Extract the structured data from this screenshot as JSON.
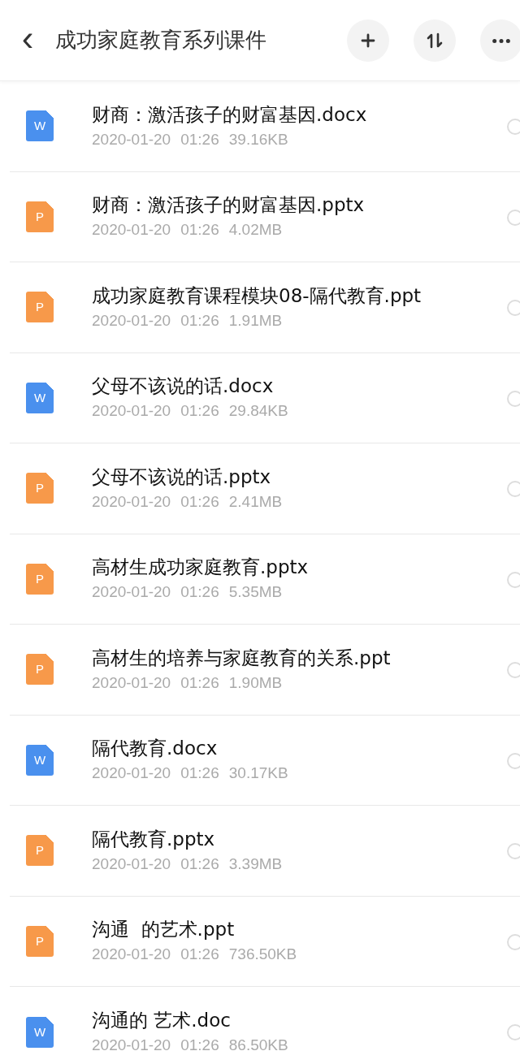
{
  "header": {
    "back": "‹",
    "title": "成功家庭教育系列课件",
    "actions": [
      {
        "kind": "add"
      },
      {
        "kind": "sort"
      },
      {
        "kind": "more"
      }
    ]
  },
  "files": [
    {
      "kind": "word",
      "badge": "W",
      "name": "财商：激活孩子的财富基因.docx",
      "date": "2020-01-20",
      "time": "01:26",
      "size": "39.16KB",
      "selected": false
    },
    {
      "kind": "ppt",
      "badge": "P",
      "name": "财商：激活孩子的财富基因.pptx",
      "date": "2020-01-20",
      "time": "01:26",
      "size": "4.02MB",
      "selected": false
    },
    {
      "kind": "ppt",
      "badge": "P",
      "name": "成功家庭教育课程模块08-隔代教育.ppt",
      "date": "2020-01-20",
      "time": "01:26",
      "size": "1.91MB",
      "selected": false
    },
    {
      "kind": "word",
      "badge": "W",
      "name": "父母不该说的话.docx",
      "date": "2020-01-20",
      "time": "01:26",
      "size": "29.84KB",
      "selected": false
    },
    {
      "kind": "ppt",
      "badge": "P",
      "name": "父母不该说的话.pptx",
      "date": "2020-01-20",
      "time": "01:26",
      "size": "2.41MB",
      "selected": false
    },
    {
      "kind": "ppt",
      "badge": "P",
      "name": "高材生成功家庭教育.pptx",
      "date": "2020-01-20",
      "time": "01:26",
      "size": "5.35MB",
      "selected": false
    },
    {
      "kind": "ppt",
      "badge": "P",
      "name": "高材生的培养与家庭教育的关系.ppt",
      "date": "2020-01-20",
      "time": "01:26",
      "size": "1.90MB",
      "selected": false
    },
    {
      "kind": "word",
      "badge": "W",
      "name": "隔代教育.docx",
      "date": "2020-01-20",
      "time": "01:26",
      "size": "30.17KB",
      "selected": false
    },
    {
      "kind": "ppt",
      "badge": "P",
      "name": "隔代教育.pptx",
      "date": "2020-01-20",
      "time": "01:26",
      "size": "3.39MB",
      "selected": false
    },
    {
      "kind": "ppt",
      "badge": "P",
      "name": "沟通  的艺术.ppt",
      "date": "2020-01-20",
      "time": "01:26",
      "size": "736.50KB",
      "selected": false
    },
    {
      "kind": "word",
      "badge": "W",
      "name": "沟通的 艺术.doc",
      "date": "2020-01-20",
      "time": "01:26",
      "size": "86.50KB",
      "selected": false
    }
  ]
}
